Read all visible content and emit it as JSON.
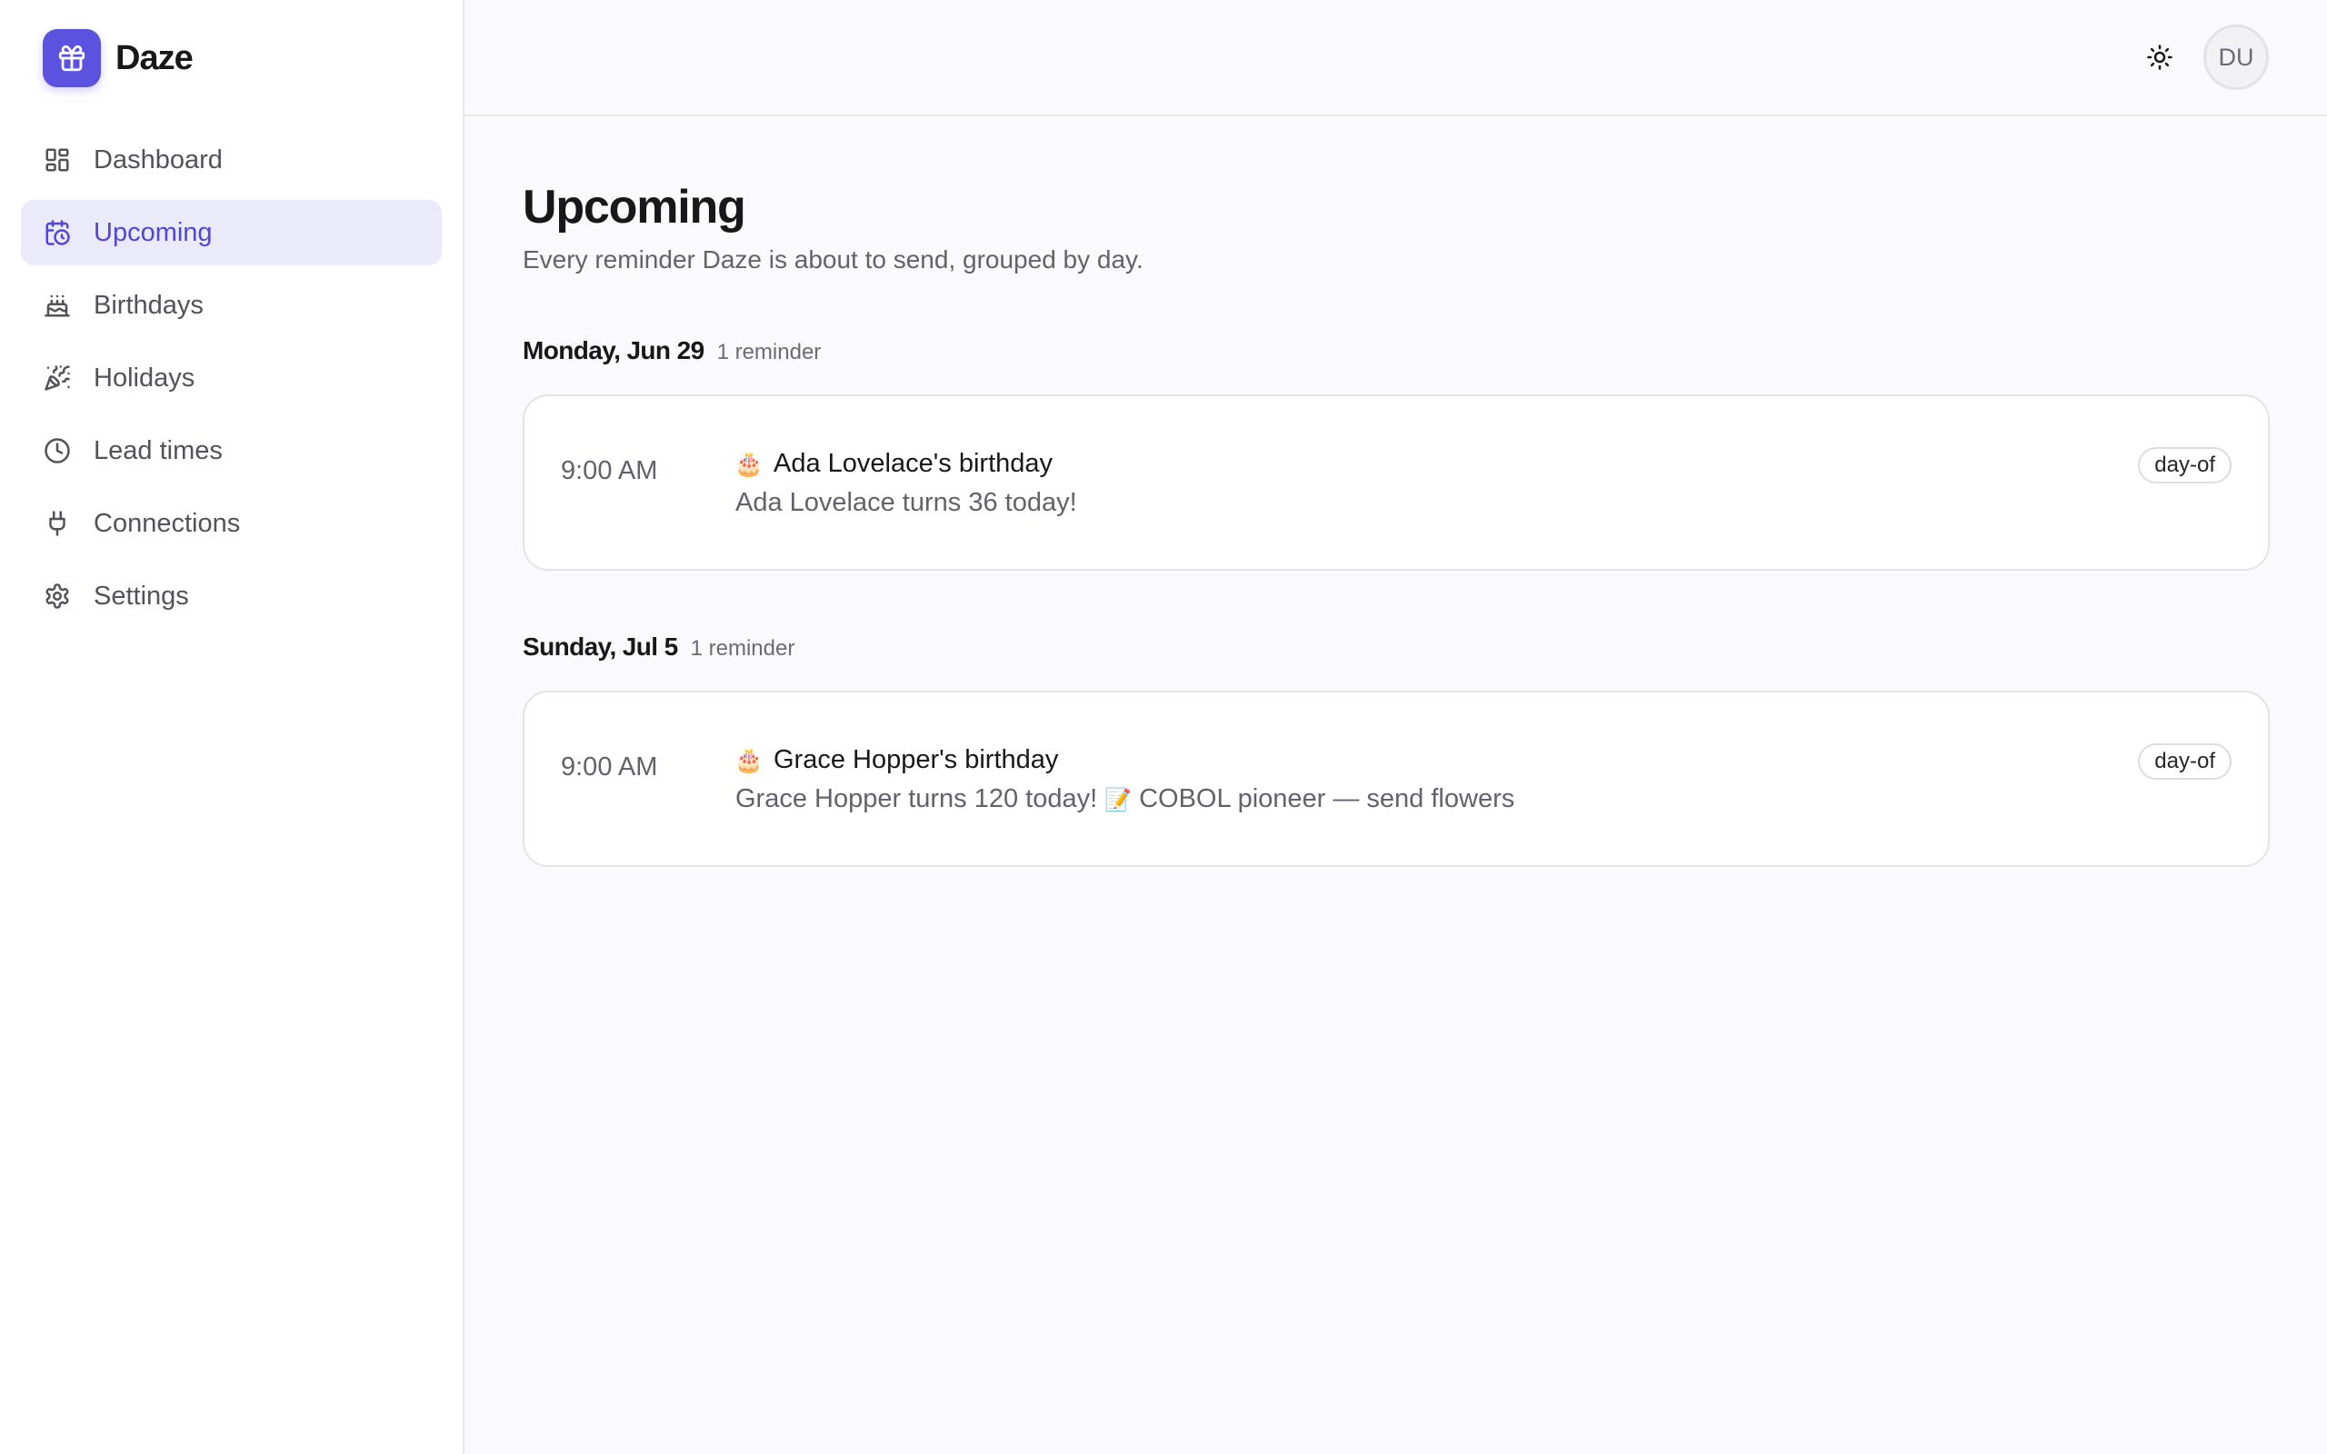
{
  "brand": {
    "name": "Daze"
  },
  "sidebar": {
    "items": [
      {
        "label": "Dashboard",
        "icon": "dashboard-icon"
      },
      {
        "label": "Upcoming",
        "icon": "calendar-clock-icon",
        "active": true
      },
      {
        "label": "Birthdays",
        "icon": "cake-icon"
      },
      {
        "label": "Holidays",
        "icon": "party-popper-icon"
      },
      {
        "label": "Lead times",
        "icon": "clock-icon"
      },
      {
        "label": "Connections",
        "icon": "plug-icon"
      },
      {
        "label": "Settings",
        "icon": "gear-icon"
      }
    ]
  },
  "topbar": {
    "avatar_initials": "DU",
    "theme_icon": "sun-icon"
  },
  "page": {
    "title": "Upcoming",
    "subtitle": "Every reminder Daze is about to send, grouped by day."
  },
  "groups": [
    {
      "day": "Monday, Jun 29",
      "count": "1 reminder",
      "reminders": [
        {
          "time": "9:00 AM",
          "emoji": "🎂",
          "title": "Ada Lovelace's birthday",
          "description": "Ada Lovelace turns 36 today!",
          "badge": "day-of"
        }
      ]
    },
    {
      "day": "Sunday, Jul 5",
      "count": "1 reminder",
      "reminders": [
        {
          "time": "9:00 AM",
          "emoji": "🎂",
          "title": "Grace Hopper's birthday",
          "description": "Grace Hopper turns 120 today!",
          "note_emoji": "📝",
          "note": "COBOL pioneer — send flowers",
          "badge": "day-of"
        }
      ]
    }
  ],
  "colors": {
    "accent": "#5b52e0",
    "active_bg": "#ebeafb",
    "active_text": "#5046d9"
  }
}
